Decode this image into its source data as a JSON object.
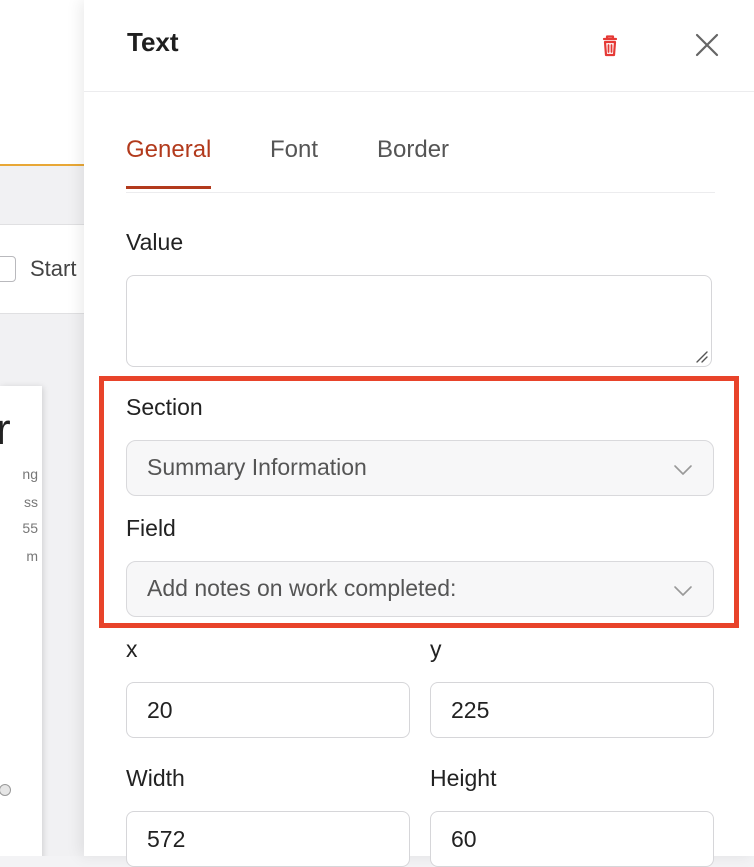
{
  "background": {
    "toolbar_label": "Start",
    "canvas_letter": "r",
    "canvas_snippets": [
      "ng",
      "ss",
      "55",
      "m"
    ]
  },
  "panel": {
    "title": "Text",
    "tabs": [
      {
        "label": "General",
        "active": true
      },
      {
        "label": "Font",
        "active": false
      },
      {
        "label": "Border",
        "active": false
      }
    ],
    "value": {
      "label": "Value",
      "text": ""
    },
    "section": {
      "label": "Section",
      "selected": "Summary Information"
    },
    "field": {
      "label": "Field",
      "selected": "Add notes on work completed:"
    },
    "x": {
      "label": "x",
      "value": "20"
    },
    "y": {
      "label": "y",
      "value": "225"
    },
    "width": {
      "label": "Width",
      "value": "572"
    },
    "height": {
      "label": "Height",
      "value": "60"
    }
  },
  "colors": {
    "accent": "#b23a1c",
    "highlight": "#e8432a",
    "trash": "#e53935"
  },
  "icons": [
    "trash-icon",
    "close-icon",
    "chevron-down-icon",
    "resize-grip-icon"
  ]
}
